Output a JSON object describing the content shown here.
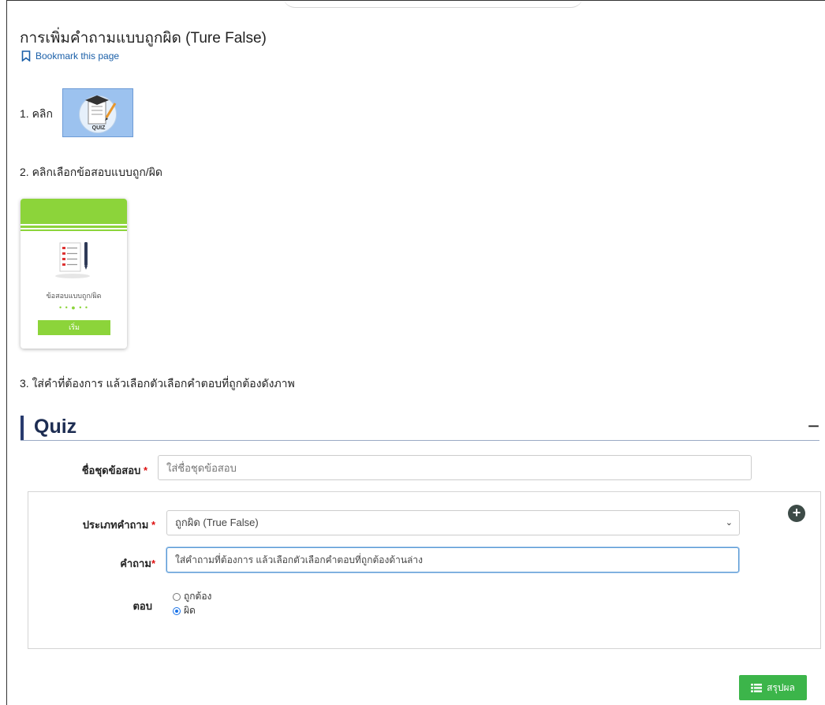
{
  "page": {
    "title": "การเพิ่มคำถามแบบถูกผิด (Ture False)",
    "bookmark_label": "Bookmark this page"
  },
  "steps": {
    "step1": "1. คลิก",
    "step2": "2. คลิกเลือกข้อสอบแบบถูก/ผิด",
    "step3": "3. ใส่คำที่ต้องการ แล้วเลือกตัวเลือกคำตอบที่ถูกต้องดังภาพ"
  },
  "quiz_icon": {
    "text": "QUIZ"
  },
  "card": {
    "label": "ข้อสอบแบบถูก/ผิด",
    "dots": "• • ● • •",
    "start_label": "เริ่ม"
  },
  "quiz_section": {
    "title": "Quiz",
    "collapse_icon": "minus-icon"
  },
  "form": {
    "set_name_label": "ชื่อชุดข้อสอบ",
    "set_name_placeholder": "ใส่ชื่อชุดข้อสอบ",
    "question_type_label": "ประเภทคำถาม",
    "question_type_value": "ถูกผิด (True False)",
    "question_label": "คำถาม",
    "question_value": "ใส่คำถามที่ต้องการ แล้วเลือกตัวเลือกคำตอบที่ถูกต้องด้านล่าง",
    "answer_label": "ตอบ",
    "answers": [
      {
        "label": "ถูกต้อง",
        "checked": false
      },
      {
        "label": "ผิด",
        "checked": true
      }
    ],
    "required_mark": "*",
    "add_icon": "plus-icon"
  },
  "summary_button": {
    "label": "สรุปผล",
    "icon": "list-icon"
  },
  "colors": {
    "accent_green": "#3cb54a",
    "card_green": "#8cd43a",
    "quiz_bar": "#283b6e",
    "link_blue": "#1a5fa8"
  }
}
